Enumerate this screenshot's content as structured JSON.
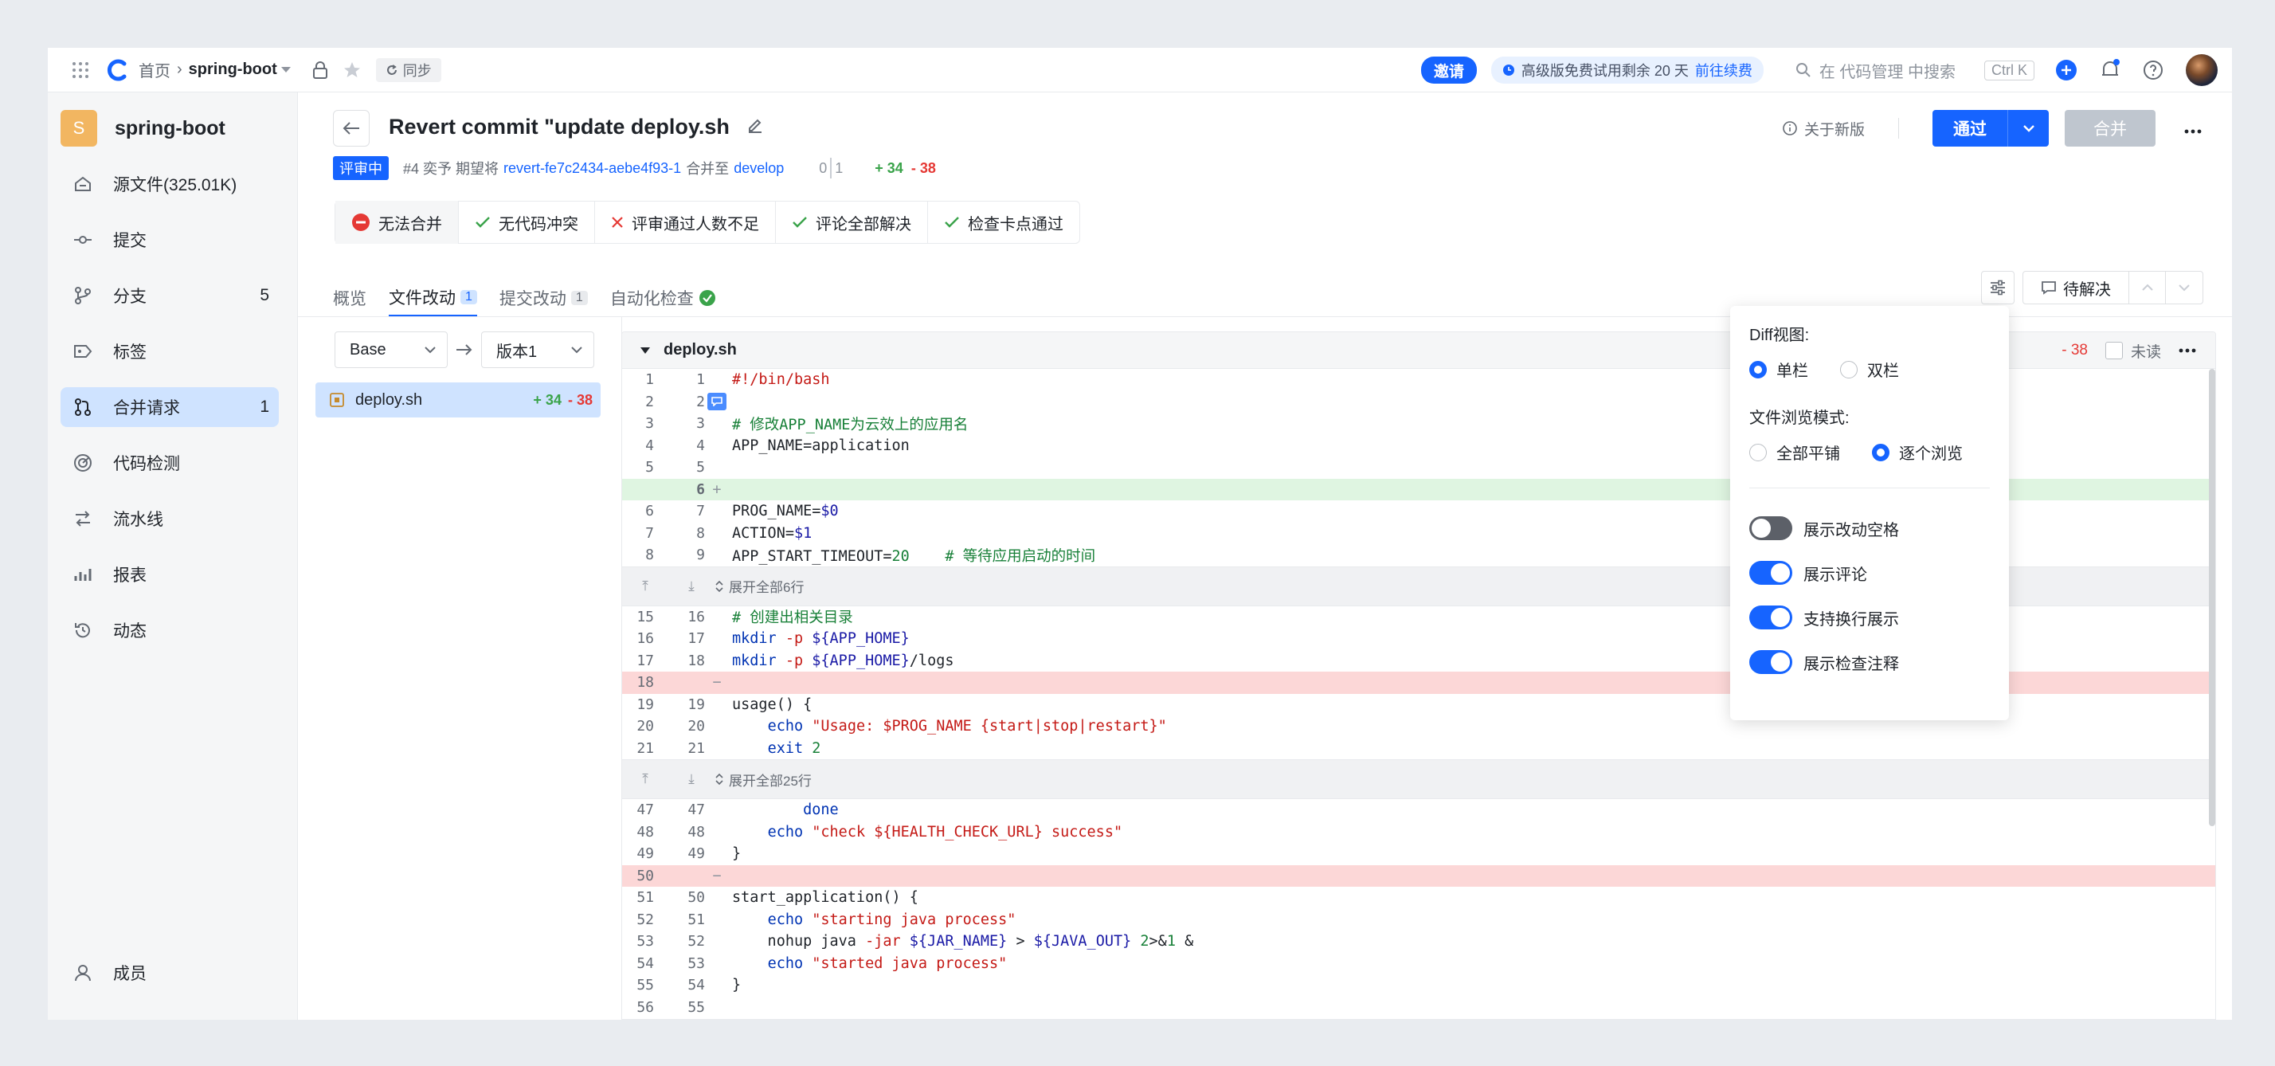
{
  "topbar": {
    "breadcrumb_home": "首页",
    "breadcrumb_repo": "spring-boot",
    "sync_label": "同步",
    "invite_label": "邀请",
    "trial_text": "高级版免费试用剩余 20 天",
    "trial_link": "前往续费",
    "search_placeholder": "在 代码管理 中搜索",
    "shortcut": "Ctrl K"
  },
  "sidebar": {
    "repo_initial": "S",
    "repo_name": "spring-boot",
    "items": [
      {
        "label": "源文件(325.01K)",
        "icon": "home-icon"
      },
      {
        "label": "提交",
        "icon": "commit-icon"
      },
      {
        "label": "分支",
        "icon": "branch-icon",
        "count": "5"
      },
      {
        "label": "标签",
        "icon": "tag-icon"
      },
      {
        "label": "合并请求",
        "icon": "merge-request-icon",
        "count": "1",
        "active": true
      },
      {
        "label": "代码检测",
        "icon": "scan-icon"
      },
      {
        "label": "流水线",
        "icon": "pipeline-icon"
      },
      {
        "label": "报表",
        "icon": "chart-icon"
      },
      {
        "label": "动态",
        "icon": "history-icon"
      }
    ],
    "members_label": "成员"
  },
  "mr": {
    "title": "Revert commit \"update deploy.sh",
    "status": "评审中",
    "meta_prefix": "#4 奕予 期望将",
    "source_branch": "revert-fe7c2434-aebe4f93-1",
    "merge_into": "合并至",
    "target_branch": "develop",
    "commits_behind": "0",
    "commits_ahead": "1",
    "additions": "+ 34",
    "deletions": "- 38",
    "about_label": "关于新版",
    "approve_label": "通过",
    "merge_label": "合并"
  },
  "checks": [
    {
      "label": "无法合并",
      "state": "blocked"
    },
    {
      "label": "无代码冲突",
      "state": "ok"
    },
    {
      "label": "评审通过人数不足",
      "state": "fail"
    },
    {
      "label": "评论全部解决",
      "state": "ok"
    },
    {
      "label": "检查卡点通过",
      "state": "ok"
    }
  ],
  "tabs": [
    {
      "label": "概览"
    },
    {
      "label": "文件改动",
      "count": "1",
      "active": true
    },
    {
      "label": "提交改动",
      "count": "1"
    },
    {
      "label": "自动化检查"
    }
  ],
  "toolbar": {
    "pending_label": "待解决"
  },
  "file_tree": {
    "base_label": "Base",
    "version_label": "版本1",
    "file_name": "deploy.sh",
    "additions": "+ 34",
    "deletions": "- 38"
  },
  "diff": {
    "file_name": "deploy.sh",
    "deletions": "- 38",
    "unread_label": "未读",
    "expand_1": "展开全部6行",
    "expand_2": "展开全部25行"
  },
  "popover": {
    "diff_view_title": "Diff视图:",
    "single_label": "单栏",
    "double_label": "双栏",
    "browse_title": "文件浏览模式:",
    "all_label": "全部平铺",
    "each_label": "逐个浏览",
    "toggles": [
      {
        "label": "展示改动空格",
        "on": false
      },
      {
        "label": "展示评论",
        "on": true
      },
      {
        "label": "支持换行展示",
        "on": true
      },
      {
        "label": "展示检查注释",
        "on": true
      }
    ]
  },
  "colors": {
    "accent": "#1664ff",
    "add_bg": "#dff5e1",
    "del_bg": "#fcd7d7",
    "active_bg": "#cfe3ff"
  }
}
